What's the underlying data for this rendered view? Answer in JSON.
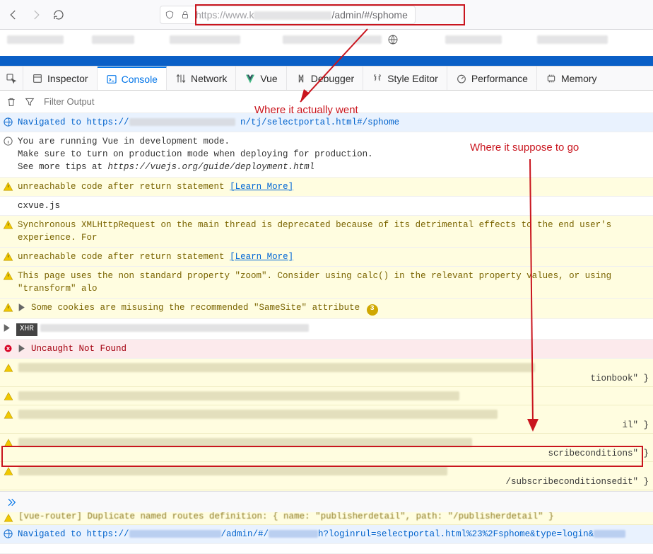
{
  "url_bar": {
    "prefix": "https://www.k",
    "suffix": "/admin/#/sphome"
  },
  "devtools_tabs": {
    "inspector": "Inspector",
    "console": "Console",
    "network": "Network",
    "vue": "Vue",
    "debugger": "Debugger",
    "style_editor": "Style Editor",
    "performance": "Performance",
    "memory": "Memory"
  },
  "filter": {
    "placeholder": "Filter Output"
  },
  "logs": {
    "nav1_a": "Navigated to https://",
    "nav1_b": "n/tj/selectportal.html#/sphome",
    "vue_info_1": "You are running Vue in development mode.",
    "vue_info_2": "Make sure to turn on production mode when deploying for production.",
    "vue_info_3": "See more tips at ",
    "vue_info_link": "https://vuejs.org/guide/deployment.html",
    "warn_unreachable": "unreachable code after return statement ",
    "learn_more": "[Learn More]",
    "cxvue": "cxvue.js",
    "warn_xhr": "Synchronous XMLHttpRequest on the main thread is deprecated because of its detrimental effects to the end user's experience. For",
    "warn_zoom": "This page uses the non standard property \"zoom\". Consider using calc() in the relevant property values, or using \"transform\" alo",
    "warn_cookies": "Some cookies are misusing the recommended \"SameSite\" attribute",
    "cookies_count": "3",
    "xhr_label": "XHR",
    "err_uncaught": "Uncaught Not Found",
    "suffix_tionbook": "tionbook\" }",
    "suffix_il": "il\" }",
    "suffix_scribeconditions": "scribeconditions\" }",
    "suffix_subscribeconditionsedit": "/subscribeconditionsedit\" }",
    "router_dup": "[vue-router] Duplicate named routes definition: { name: \"publisherdetail\", path: \"/publisherdetail\" }",
    "nav2_a": "Navigated to https://",
    "nav2_b": "/admin/#/",
    "nav2_c": "h?loginrul=selectportal.html%23%2Fsphome&type=login&"
  },
  "annotations": {
    "where_went": "Where it actually went",
    "where_suppose": "Where it suppose to go"
  }
}
